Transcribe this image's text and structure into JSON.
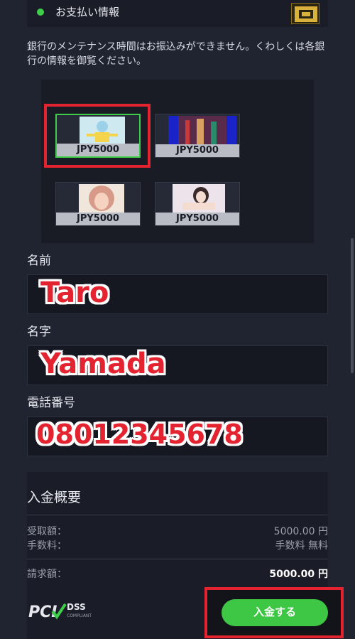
{
  "header": {
    "title": "お支払い情報"
  },
  "notice": "銀行のメンテナンス時間はお振込みができません。くわしくは各銀行の情報を御覧ください。",
  "cards": [
    {
      "amount": "JPY5000",
      "selected": true
    },
    {
      "amount": "JPY5000",
      "selected": false
    },
    {
      "amount": "JPY5000",
      "selected": false
    },
    {
      "amount": "JPY5000",
      "selected": false
    }
  ],
  "form": {
    "first_name_label": "名前",
    "first_name_value": "Taro",
    "last_name_label": "名字",
    "last_name_value": "Yamada",
    "phone_label": "電話番号",
    "phone_value": "08012345678"
  },
  "summary": {
    "title": "入金概要",
    "received_label": "受取額：",
    "received_value": "5000.00 円",
    "fee_label": "手数料：",
    "fee_value": "手数料 無料",
    "billed_label": "請求額：",
    "billed_value": "5000.00 円"
  },
  "pci": {
    "brand": "PCI",
    "dss": "DSS",
    "compliant": "COMPLIANT"
  },
  "submit_label": "入金する",
  "colors": {
    "accent": "#3ec745",
    "highlight": "#e3232f",
    "background": "#202431"
  }
}
